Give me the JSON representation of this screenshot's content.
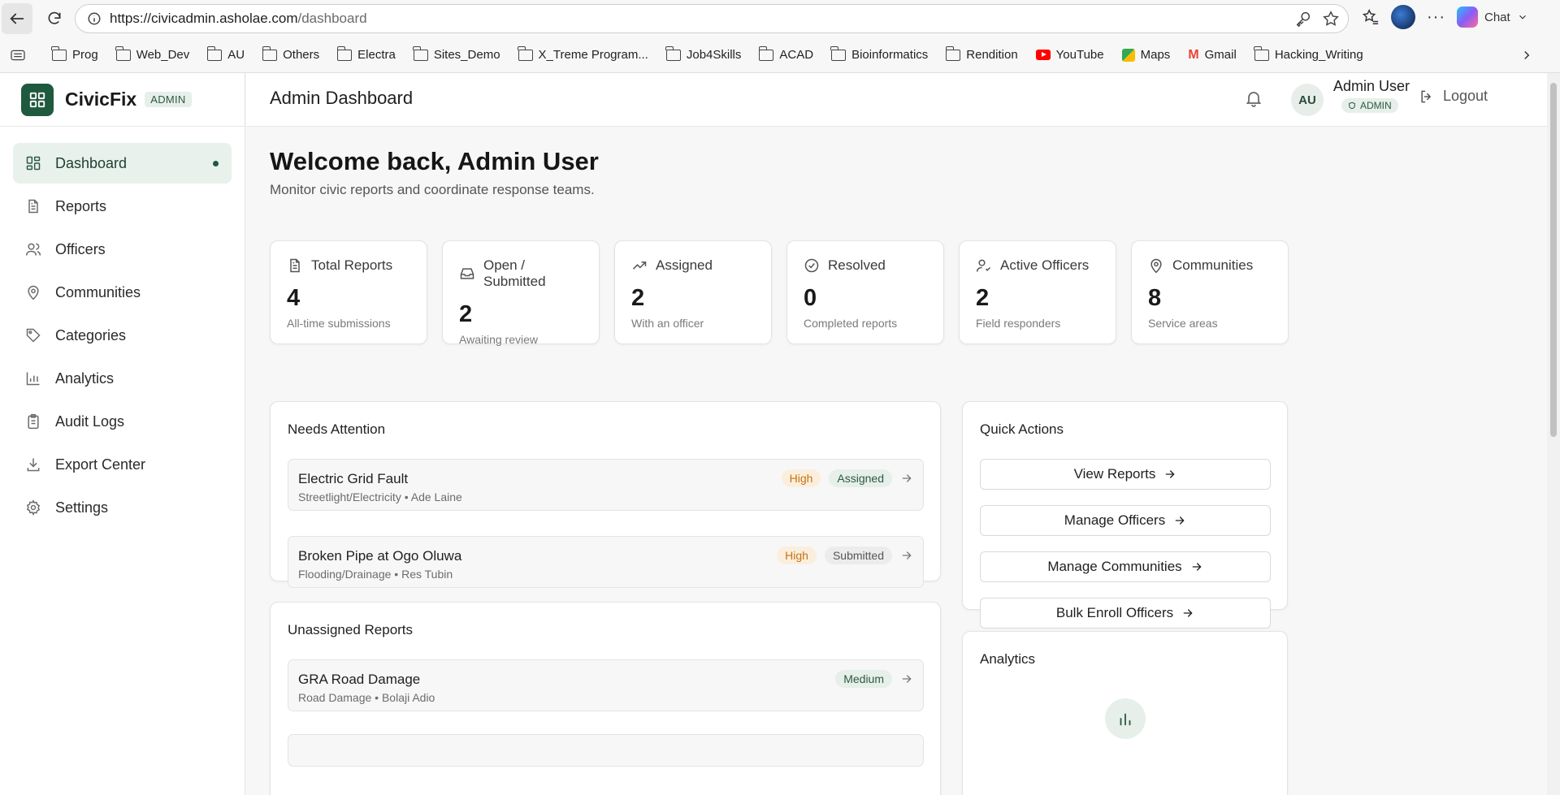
{
  "browser": {
    "url_host": "https://civicadmin.asholae.com",
    "url_path": "/dashboard",
    "chat_label": "Chat"
  },
  "bookmarks": [
    "Prog",
    "Web_Dev",
    "AU",
    "Others",
    "Electra",
    "Sites_Demo",
    "X_Treme Program...",
    "Job4Skills",
    "ACAD",
    "Bioinformatics",
    "Rendition",
    "YouTube",
    "Maps",
    "Gmail",
    "Hacking_Writing"
  ],
  "brand": {
    "name": "CivicFix",
    "badge": "ADMIN",
    "color": "#1f5a3f"
  },
  "sidebar": {
    "items": [
      {
        "label": "Dashboard",
        "icon": "dashboard-icon",
        "active": true
      },
      {
        "label": "Reports",
        "icon": "document-icon"
      },
      {
        "label": "Officers",
        "icon": "users-icon"
      },
      {
        "label": "Communities",
        "icon": "map-pin-icon"
      },
      {
        "label": "Categories",
        "icon": "tag-icon"
      },
      {
        "label": "Analytics",
        "icon": "bar-chart-icon"
      },
      {
        "label": "Audit Logs",
        "icon": "clipboard-icon"
      },
      {
        "label": "Export Center",
        "icon": "download-icon"
      },
      {
        "label": "Settings",
        "icon": "gear-icon"
      }
    ]
  },
  "header": {
    "title": "Admin Dashboard",
    "avatar": "AU",
    "user_name": "Admin User",
    "user_role": "ADMIN",
    "logout": "Logout"
  },
  "main": {
    "welcome": "Welcome back, Admin User",
    "subtitle": "Monitor civic reports and coordinate response teams."
  },
  "stats": [
    {
      "label": "Total Reports",
      "value": "4",
      "sub": "All-time submissions",
      "icon": "document-icon"
    },
    {
      "label": "Open / Submitted",
      "value": "2",
      "sub": "Awaiting review",
      "icon": "inbox-icon"
    },
    {
      "label": "Assigned",
      "value": "2",
      "sub": "With an officer",
      "icon": "trending-up-icon"
    },
    {
      "label": "Resolved",
      "value": "0",
      "sub": "Completed reports",
      "icon": "check-circle-icon"
    },
    {
      "label": "Active Officers",
      "value": "2",
      "sub": "Field responders",
      "icon": "user-check-icon"
    },
    {
      "label": "Communities",
      "value": "8",
      "sub": "Service areas",
      "icon": "map-pin-icon"
    }
  ],
  "needs_attention": {
    "title": "Needs Attention",
    "items": [
      {
        "title": "Electric Grid Fault",
        "meta": "Streetlight/Electricity • Ade Laine",
        "priority": "High",
        "status": "Assigned"
      },
      {
        "title": "Broken Pipe at Ogo Oluwa",
        "meta": "Flooding/Drainage • Res Tubin",
        "priority": "High",
        "status": "Submitted"
      }
    ]
  },
  "unassigned": {
    "title": "Unassigned Reports",
    "items": [
      {
        "title": "GRA Road Damage",
        "meta": "Road Damage • Bolaji Adio",
        "priority": "Medium"
      }
    ]
  },
  "quick_actions": {
    "title": "Quick Actions",
    "buttons": [
      "View Reports",
      "Manage Officers",
      "Manage Communities",
      "Bulk Enroll Officers"
    ]
  },
  "analytics": {
    "title": "Analytics"
  }
}
